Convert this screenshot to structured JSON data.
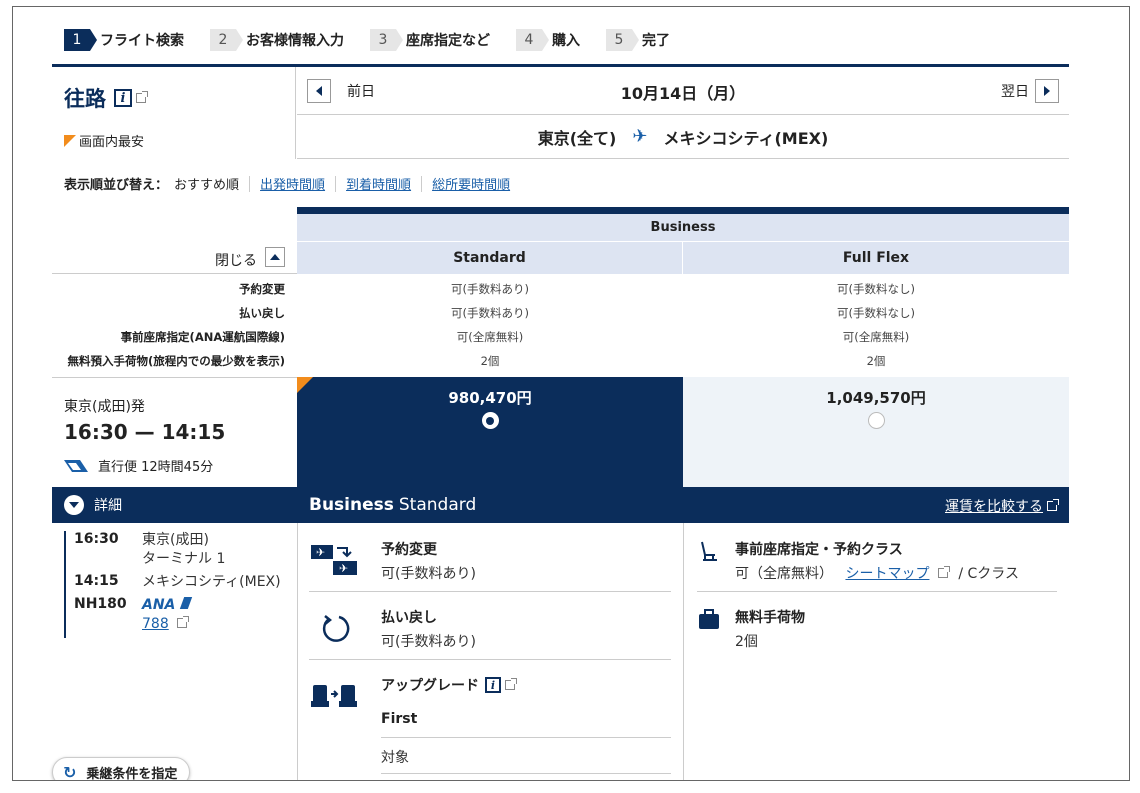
{
  "steps": [
    {
      "num": "1",
      "label": "フライト検索"
    },
    {
      "num": "2",
      "label": "お客様情報入力"
    },
    {
      "num": "3",
      "label": "座席指定など"
    },
    {
      "num": "4",
      "label": "購入"
    },
    {
      "num": "5",
      "label": "完了"
    }
  ],
  "route": {
    "title": "往路",
    "info_icon": "i",
    "cheapest_label": "画面内最安",
    "prev_label": "前日",
    "next_label": "翌日",
    "date": "10月14日（月）",
    "origin": "東京(全て)",
    "destination": "メキシコシティ(MEX)"
  },
  "sort": {
    "label": "表示順並び替え：",
    "current": "おすすめ順",
    "options": [
      "出発時間順",
      "到着時間順",
      "総所要時間順"
    ]
  },
  "fare": {
    "cabin": "Business",
    "close_label": "閉じる",
    "columns": [
      "Standard",
      "Full Flex"
    ],
    "conditions": {
      "labels": [
        "予約変更",
        "払い戻し",
        "事前座席指定(ANA運航国際線)",
        "無料預入手荷物(旅程内での最少数を表示)"
      ],
      "standard": [
        "可(手数料あり)",
        "可(手数料あり)",
        "可(全席無料)",
        "2個"
      ],
      "fullflex": [
        "可(手数料なし)",
        "可(手数料なし)",
        "可(全席無料)",
        "2個"
      ]
    },
    "prices": [
      "980,470円",
      "1,049,570円"
    ],
    "selected": "Standard"
  },
  "flight": {
    "departure_label": "東京(成田)発",
    "times": "16:30 — 14:15",
    "direct": "直行便 12時間45分",
    "details_label": "詳細",
    "itinerary": [
      {
        "t": "16:30",
        "v": "東京(成田)"
      },
      {
        "t": "",
        "v": "ターミナル 1"
      },
      {
        "t": "14:15",
        "v": "メキシコシティ(MEX)"
      },
      {
        "t": "NH180",
        "v": "ANA"
      }
    ],
    "aircraft": "788"
  },
  "details": {
    "cabin": "Business",
    "fare": "Standard",
    "compare_label": "運賃を比較する",
    "features_left": [
      {
        "icon": "flight-change-icon",
        "title": "予約変更",
        "value": "可(手数料あり)"
      },
      {
        "icon": "refund-icon",
        "title": "払い戻し",
        "value": "可(手数料あり)"
      },
      {
        "icon": "upgrade-seat-icon",
        "title": "アップグレード",
        "value": "First",
        "extra": "対象"
      }
    ],
    "seat": {
      "title": "事前座席指定・予約クラス",
      "prefix": "可（全席無料）",
      "link": "シートマップ",
      "suffix": "/ Cクラス"
    },
    "baggage": {
      "title": "無料手荷物",
      "value": "2個"
    }
  },
  "transfer_button": "乗継条件を指定",
  "colors": {
    "navy": "#0b2d5b",
    "accent": "#f28c1c",
    "link": "#1a5fa8",
    "light": "#dde4f2"
  }
}
